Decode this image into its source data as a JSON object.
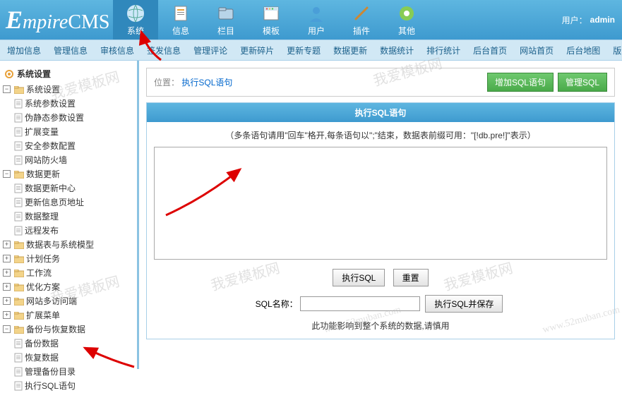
{
  "header": {
    "logo": "EmpireCMS",
    "user_label": "用户：",
    "user_name": "admin",
    "nav": [
      {
        "label": "系统",
        "icon": "globe"
      },
      {
        "label": "信息",
        "icon": "doc"
      },
      {
        "label": "栏目",
        "icon": "folder"
      },
      {
        "label": "模板",
        "icon": "window"
      },
      {
        "label": "用户",
        "icon": "person"
      },
      {
        "label": "插件",
        "icon": "plugin"
      },
      {
        "label": "其他",
        "icon": "misc"
      }
    ]
  },
  "subnav": [
    "增加信息",
    "管理信息",
    "审核信息",
    "签发信息",
    "管理评论",
    "更新碎片",
    "更新专题",
    "数据更新",
    "数据统计",
    "排行统计",
    "后台首页",
    "网站首页",
    "后台地图",
    "版"
  ],
  "sidebar": {
    "title": "系统设置",
    "tree": [
      {
        "label": "系统设置",
        "expanded": true,
        "children": [
          {
            "label": "系统参数设置"
          },
          {
            "label": "伪静态参数设置"
          },
          {
            "label": "扩展变量"
          },
          {
            "label": "安全参数配置"
          },
          {
            "label": "网站防火墙"
          }
        ]
      },
      {
        "label": "数据更新",
        "expanded": true,
        "children": [
          {
            "label": "数据更新中心"
          },
          {
            "label": "更新信息页地址"
          },
          {
            "label": "数据整理"
          },
          {
            "label": "远程发布"
          }
        ]
      },
      {
        "label": "数据表与系统模型",
        "expanded": false
      },
      {
        "label": "计划任务",
        "expanded": false
      },
      {
        "label": "工作流",
        "expanded": false
      },
      {
        "label": "优化方案",
        "expanded": false
      },
      {
        "label": "网站多访问端",
        "expanded": false
      },
      {
        "label": "扩展菜单",
        "expanded": false
      },
      {
        "label": "备份与恢复数据",
        "expanded": true,
        "children": [
          {
            "label": "备份数据"
          },
          {
            "label": "恢复数据"
          },
          {
            "label": "管理备份目录"
          },
          {
            "label": "执行SQL语句"
          }
        ]
      }
    ]
  },
  "content": {
    "breadcrumb_label": "位置：",
    "breadcrumb_value": "执行SQL语句",
    "btn_add": "增加SQL语句",
    "btn_manage": "管理SQL",
    "panel_title": "执行SQL语句",
    "hint": "（多条语句请用\"回车\"格开,每条语句以\";\"结束，数据表前缀可用：\"[!db.pre!]\"表示）",
    "btn_exec": "执行SQL",
    "btn_reset": "重置",
    "name_label": "SQL名称：",
    "btn_save": "执行SQL并保存",
    "warning": "此功能影响到整个系统的数据,请慎用"
  },
  "watermark": "我爱模板网",
  "watermark_url": "www.52muban.com"
}
